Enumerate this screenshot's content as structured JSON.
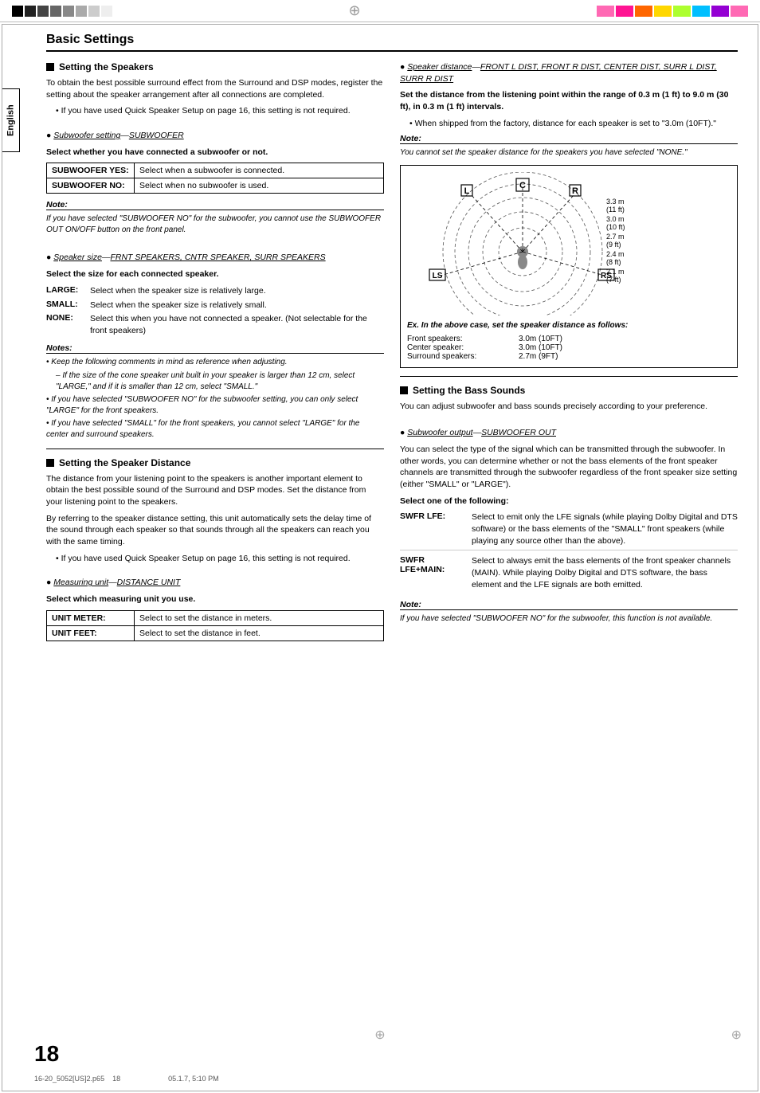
{
  "page": {
    "number": "18",
    "footer_file": "16-20_5052[US]2.p65",
    "footer_page": "18",
    "footer_date": "05.1.7, 5:10 PM"
  },
  "section_title": "Basic Settings",
  "english_label": "English",
  "left_col": {
    "setting_speakers_title": "Setting the Speakers",
    "setting_speakers_intro": "To obtain the best possible surround effect from the Surround and DSP modes, register the setting about the speaker arrangement after all connections are completed.",
    "setting_speakers_bullet1": "If you have used Quick Speaker Setup on page 16, this setting is not required.",
    "subwoofer_setting_label": "Subwoofer setting",
    "subwoofer_setting_value": "SUBWOOFER",
    "subwoofer_bold": "Select whether you have connected a subwoofer or not.",
    "subwoofer_yes_label": "SUBWOOFER YES:",
    "subwoofer_yes_desc": "Select when a subwoofer is connected.",
    "subwoofer_no_label": "SUBWOOFER NO:",
    "subwoofer_no_desc": "Select when no subwoofer is used.",
    "note1_title": "Note:",
    "note1_text": "If you have selected \"SUBWOOFER NO\" for the subwoofer, you cannot use the SUBWOOFER OUT ON/OFF button on the front panel.",
    "speaker_size_label": "Speaker size",
    "speaker_size_value": "FRNT SPEAKERS, CNTR SPEAKER, SURR SPEAKERS",
    "speaker_size_bold": "Select the size for each connected speaker.",
    "large_label": "LARGE:",
    "large_desc": "Select when the speaker size is relatively large.",
    "small_label": "SMALL:",
    "small_desc": "Select when the speaker size is relatively small.",
    "none_label": "NONE:",
    "none_desc": "Select this when you have not connected a speaker. (Not selectable for the front speakers)",
    "notes2_title": "Notes:",
    "notes2_items": [
      "Keep the following comments in mind as reference when adjusting.",
      "If the size of the cone speaker unit built in your speaker is larger than 12 cm, select \"LARGE,\" and if it is smaller than 12 cm, select \"SMALL.\"",
      "If you have selected \"SUBWOOFER NO\" for the subwoofer setting, you can only select \"LARGE\" for the front speakers.",
      "If you have selected \"SMALL\" for the front speakers, you cannot select \"LARGE\" for the center and surround speakers."
    ],
    "setting_distance_title": "Setting the Speaker Distance",
    "setting_distance_para1": "The distance from your listening point to the speakers is another important element to obtain the best possible sound of the Surround and DSP modes. Set the distance from your listening point to the speakers.",
    "setting_distance_para2": "By referring to the speaker distance setting, this unit automatically sets the delay time of the sound through each speaker so that sounds through all the speakers can reach you with the same timing.",
    "setting_distance_bullet1": "If you have used Quick Speaker Setup on page 16, this setting is not required.",
    "measuring_unit_label": "Measuring unit",
    "measuring_unit_value": "DISTANCE UNIT",
    "measuring_unit_bold": "Select which measuring unit you use.",
    "unit_meter_label": "UNIT METER:",
    "unit_meter_desc": "Select to set the distance in meters.",
    "unit_feet_label": "UNIT FEET:",
    "unit_feet_desc": "Select to set the distance in feet."
  },
  "right_col": {
    "speaker_distance_label": "Speaker distance",
    "speaker_distance_value": "FRONT L DIST, FRONT R DIST, CENTER DIST, SURR L DIST, SURR R DIST",
    "speaker_distance_bold": "Set the distance from the listening point within the range of 0.3 m (1 ft) to 9.0 m (30 ft), in 0.3 m (1 ft) intervals.",
    "speaker_distance_bullet1": "When shipped from the factory, distance for each speaker is set to \"3.0m (10FT).\"",
    "note3_title": "Note:",
    "note3_text": "You cannot set the speaker distance for the speakers you have selected \"NONE.\"",
    "diagram_caption": "Ex. In the above case, set the speaker distance as follows:",
    "diagram_front_speakers": "Front speakers:",
    "diagram_front_value": "3.0m (10FT)",
    "diagram_center_speaker": "Center speaker:",
    "diagram_center_value": "3.0m (10FT)",
    "diagram_surround_speakers": "Surround speakers:",
    "diagram_surround_value": "2.7m (9FT)",
    "diagram_distances": [
      "3.3 m (11 ft)",
      "3.0 m (10 ft)",
      "2.7 m (9 ft)",
      "2.4 m (8 ft)",
      "2.1 m (7 ft)"
    ],
    "diagram_labels": {
      "C": "C",
      "L": "L",
      "R": "R",
      "LS": "LS",
      "RS": "RS"
    },
    "setting_bass_title": "Setting the Bass Sounds",
    "setting_bass_intro": "You can adjust subwoofer and bass sounds precisely according to your preference.",
    "subwoofer_output_label": "Subwoofer output",
    "subwoofer_output_value": "SUBWOOFER OUT",
    "subwoofer_output_desc": "You can select the type of the signal which can be transmitted through the subwoofer. In other words, you can determine whether or not the bass elements of the front speaker channels are transmitted through the subwoofer regardless of the front speaker size setting (either \"SMALL\" or \"LARGE\").",
    "select_one_bold": "Select one of the following:",
    "swfr_lfe_label": "SWFR LFE:",
    "swfr_lfe_desc": "Select to emit only the LFE signals (while playing Dolby Digital and DTS software) or the bass elements of the \"SMALL\" front speakers (while playing any source other than the above).",
    "swfr_lfe_main_label": "SWFR LFE+MAIN:",
    "swfr_lfe_main_desc": "Select to always emit the bass elements of the front speaker channels (MAIN). While playing Dolby Digital and DTS software, the bass element and the LFE signals are both emitted.",
    "note4_title": "Note:",
    "note4_text": "If you have selected \"SUBWOOFER NO\" for the subwoofer, this function is not available."
  },
  "deco_bars_left": [
    "#000",
    "#000",
    "#333",
    "#555",
    "#777",
    "#999",
    "#bbb",
    "#ddd"
  ],
  "deco_bars_right_colors": [
    "#ff69b4",
    "#ff1493",
    "#ff6600",
    "#ffd700",
    "#adff2f",
    "#00bfff",
    "#9400d3",
    "#ff69b4"
  ]
}
